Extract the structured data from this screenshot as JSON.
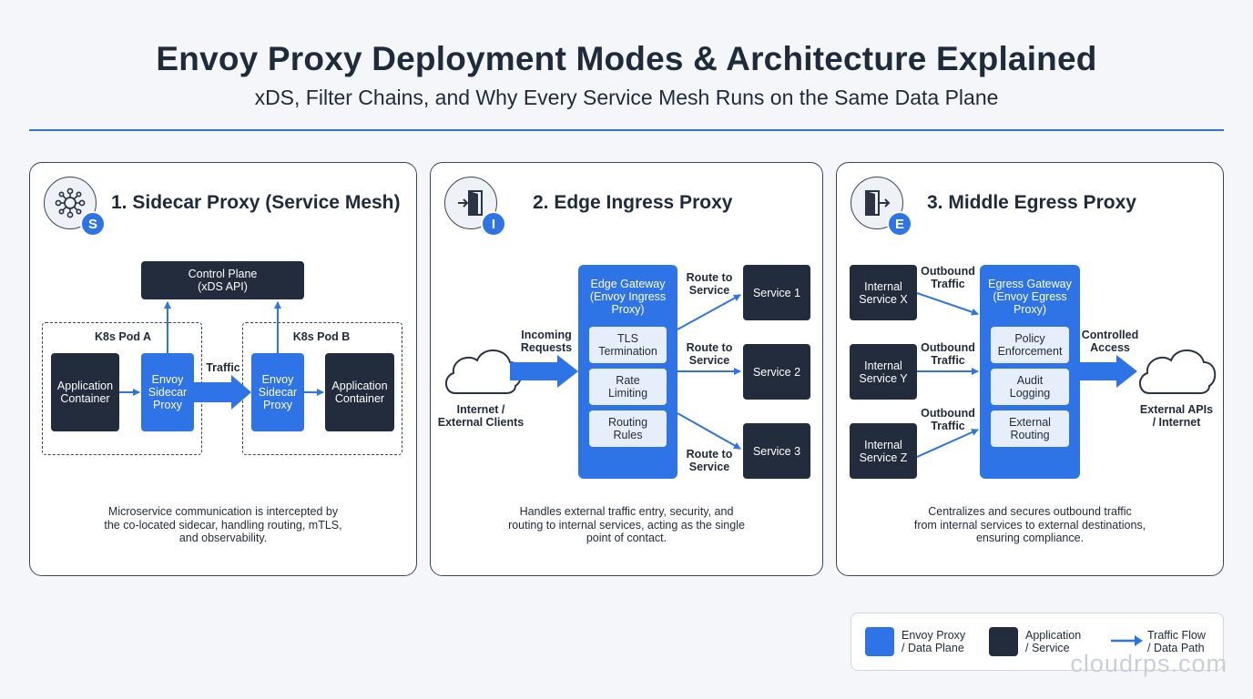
{
  "header": {
    "title": "Envoy Proxy Deployment Modes & Architecture Explained",
    "subtitle": "xDS, Filter Chains, and Why Every Service Mesh Runs on the Same Data Plane"
  },
  "panel1": {
    "badge": "S",
    "title": "1. Sidecar Proxy (Service Mesh)",
    "icon": "network-hub-icon",
    "control_plane": [
      "Control Plane",
      "(xDS API)"
    ],
    "pod_a_label": "K8s Pod A",
    "pod_b_label": "K8s Pod B",
    "app_a": [
      "Application",
      "Container"
    ],
    "proxy_a": [
      "Envoy",
      "Sidecar",
      "Proxy"
    ],
    "traffic_label": "Traffic",
    "proxy_b": [
      "Envoy",
      "Sidecar",
      "Proxy"
    ],
    "app_b": [
      "Application",
      "Container"
    ],
    "description": [
      "Microservice communication is intercepted by",
      "the co-located sidecar, handling routing, mTLS,",
      "and observability."
    ]
  },
  "panel2": {
    "badge": "I",
    "title": "2. Edge Ingress Proxy",
    "icon": "door-enter-icon",
    "client_label": [
      "Internet /",
      "External Clients"
    ],
    "incoming_label": [
      "Incoming",
      "Requests"
    ],
    "gateway_title": [
      "Edge Gateway",
      "(Envoy Ingress",
      "Proxy)"
    ],
    "filters": [
      [
        "TLS",
        "Termination"
      ],
      [
        "Rate",
        "Limiting"
      ],
      [
        "Routing",
        "Rules"
      ]
    ],
    "route_labels": [
      [
        "Route to",
        "Service"
      ],
      [
        "Route to",
        "Service"
      ],
      [
        "Route to",
        "Service"
      ]
    ],
    "services": [
      "Service 1",
      "Service 2",
      "Service 3"
    ],
    "description": [
      "Handles external traffic entry, security, and",
      "routing to internal services, acting as the single",
      "point of contact."
    ]
  },
  "panel3": {
    "badge": "E",
    "title": "3. Middle Egress Proxy",
    "icon": "door-exit-icon",
    "internal_services": [
      [
        "Internal",
        "Service X"
      ],
      [
        "Internal",
        "Service Y"
      ],
      [
        "Internal",
        "Service Z"
      ]
    ],
    "outbound_labels": [
      [
        "Outbound",
        "Traffic"
      ],
      [
        "Outbound",
        "Traffic"
      ],
      [
        "Outbound",
        "Traffic"
      ]
    ],
    "gateway_title": [
      "Egress Gateway",
      "(Envoy Egress",
      "Proxy)"
    ],
    "filters": [
      [
        "Policy",
        "Enforcement"
      ],
      [
        "Audit",
        "Logging"
      ],
      [
        "External",
        "Routing"
      ]
    ],
    "controlled_label": [
      "Controlled",
      "Access"
    ],
    "external_label": [
      "External APIs",
      "/ Internet"
    ],
    "description": [
      "Centralizes and secures outbound traffic",
      "from internal services to external destinations,",
      "ensuring compliance."
    ]
  },
  "legend": {
    "items": [
      {
        "label": [
          "Envoy Proxy",
          "/ Data Plane"
        ],
        "color": "#2f74e6"
      },
      {
        "label": [
          "Application",
          "/ Service"
        ],
        "color": "#222c3c"
      },
      {
        "label": [
          "Traffic Flow",
          "/ Data Path"
        ],
        "color": "#2f74e6"
      }
    ]
  },
  "watermark": "cloudrps.com",
  "colors": {
    "accent": "#2f74e6",
    "dark": "#222c3c",
    "text": "#1f2a3a"
  }
}
